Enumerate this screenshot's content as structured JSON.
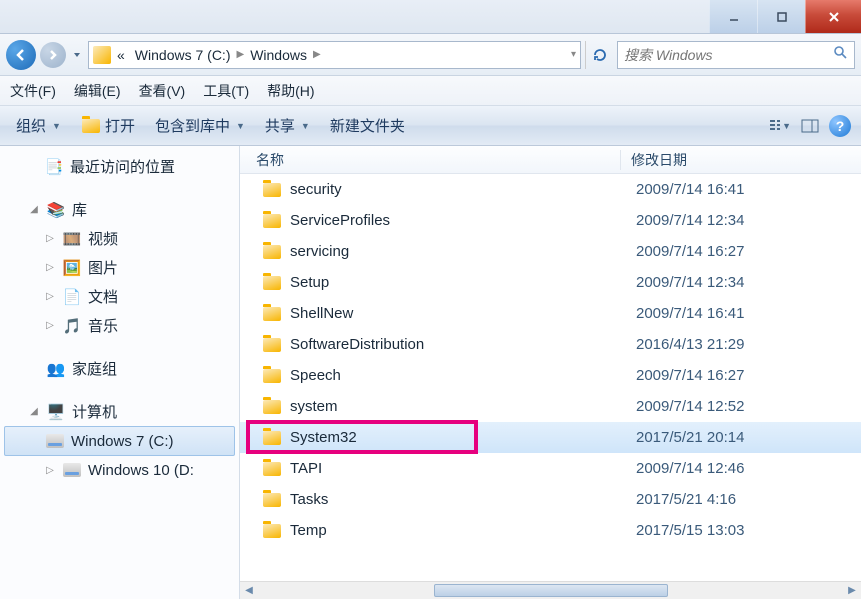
{
  "breadcrumb": {
    "chevrons": "«",
    "seg1": "Windows 7 (C:)",
    "seg2": "Windows"
  },
  "search": {
    "placeholder": "搜索 Windows"
  },
  "menu": {
    "file": "文件(F)",
    "edit": "编辑(E)",
    "view": "查看(V)",
    "tools": "工具(T)",
    "help": "帮助(H)"
  },
  "toolbar": {
    "organize": "组织",
    "open": "打开",
    "include": "包含到库中",
    "share": "共享",
    "newfolder": "新建文件夹"
  },
  "sidebar": {
    "recent": "最近访问的位置",
    "libraries": "库",
    "videos": "视频",
    "pictures": "图片",
    "documents": "文档",
    "music": "音乐",
    "homegroup": "家庭组",
    "computer": "计算机",
    "drive_c": "Windows 7 (C:)",
    "drive_d": "Windows 10 (D:"
  },
  "columns": {
    "name": "名称",
    "date": "修改日期"
  },
  "files": [
    {
      "name": "security",
      "date": "2009/7/14 16:41"
    },
    {
      "name": "ServiceProfiles",
      "date": "2009/7/14 12:34"
    },
    {
      "name": "servicing",
      "date": "2009/7/14 16:27"
    },
    {
      "name": "Setup",
      "date": "2009/7/14 12:34"
    },
    {
      "name": "ShellNew",
      "date": "2009/7/14 16:41"
    },
    {
      "name": "SoftwareDistribution",
      "date": "2016/4/13 21:29"
    },
    {
      "name": "Speech",
      "date": "2009/7/14 16:27"
    },
    {
      "name": "system",
      "date": "2009/7/14 12:52"
    },
    {
      "name": "System32",
      "date": "2017/5/21 20:14",
      "selected": true,
      "highlight": true
    },
    {
      "name": "TAPI",
      "date": "2009/7/14 12:46"
    },
    {
      "name": "Tasks",
      "date": "2017/5/21 4:16"
    },
    {
      "name": "Temp",
      "date": "2017/5/15 13:03"
    }
  ]
}
